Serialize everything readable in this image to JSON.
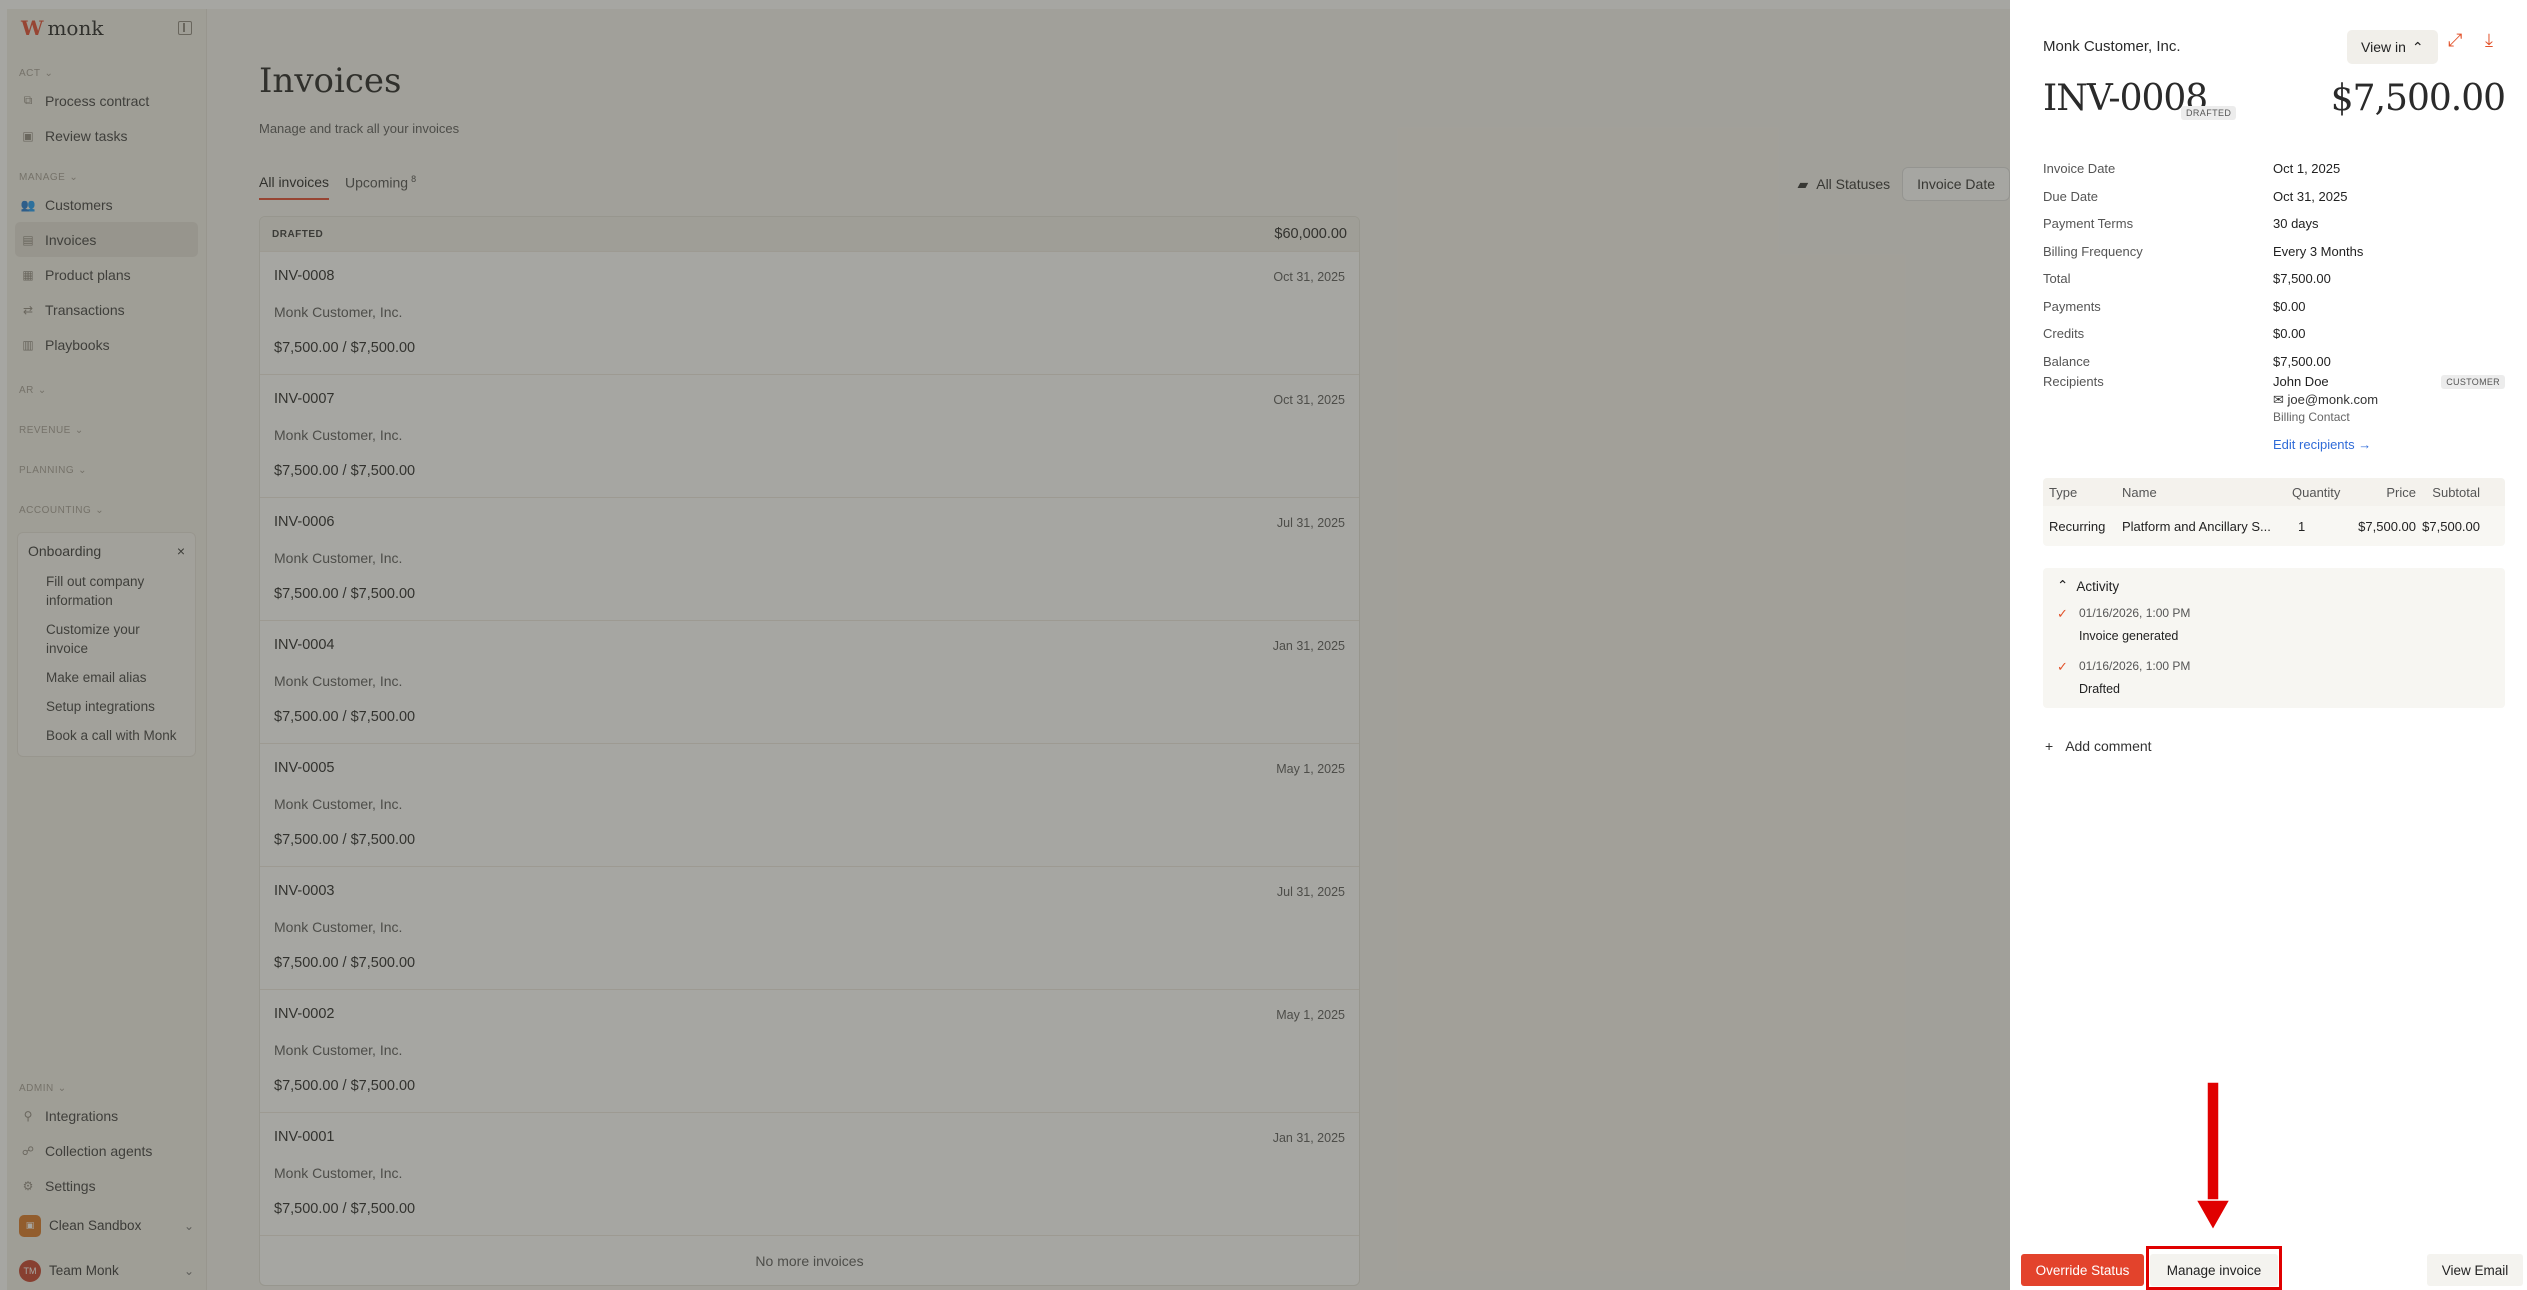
{
  "sidebar": {
    "logo": "monk",
    "sections": {
      "act": "ACT",
      "manage": "MANAGE",
      "ar": "AR",
      "revenue": "REVENUE",
      "planning": "PLANNING",
      "accounting": "ACCOUNTING",
      "admin": "ADMIN"
    },
    "act_items": [
      "Process contract",
      "Review tasks"
    ],
    "manage_items": [
      "Customers",
      "Invoices",
      "Product plans",
      "Transactions",
      "Playbooks"
    ],
    "active_item": "Invoices",
    "onboarding": {
      "title": "Onboarding",
      "items": [
        "Fill out company information",
        "Customize your invoice",
        "Make email alias",
        "Setup integrations",
        "Book a call with Monk"
      ]
    },
    "admin_items": [
      "Integrations",
      "Collection agents",
      "Settings"
    ],
    "accounts": [
      {
        "name": "Clean Sandbox",
        "initials": "",
        "color": "#d8731f"
      },
      {
        "name": "Team Monk",
        "initials": "TM",
        "color": "#c43a26"
      }
    ]
  },
  "main": {
    "title": "Invoices",
    "subtitle": "Manage and track all your invoices",
    "tabs": [
      {
        "label": "All invoices",
        "count": ""
      },
      {
        "label": "Upcoming",
        "count": "8"
      }
    ],
    "filters": {
      "status": "All Statuses",
      "date": "Invoice Date"
    },
    "group": {
      "label": "DRAFTED",
      "amount": "$60,000.00"
    },
    "invoices": [
      {
        "number": "INV-0008",
        "customer": "Monk Customer, Inc.",
        "balance": "$7,500.00 / $7,500.00",
        "date": "Oct 31, 2025"
      },
      {
        "number": "INV-0007",
        "customer": "Monk Customer, Inc.",
        "balance": "$7,500.00 / $7,500.00",
        "date": "Oct 31, 2025"
      },
      {
        "number": "INV-0006",
        "customer": "Monk Customer, Inc.",
        "balance": "$7,500.00 / $7,500.00",
        "date": "Jul 31, 2025"
      },
      {
        "number": "INV-0004",
        "customer": "Monk Customer, Inc.",
        "balance": "$7,500.00 / $7,500.00",
        "date": "Jan 31, 2025"
      },
      {
        "number": "INV-0005",
        "customer": "Monk Customer, Inc.",
        "balance": "$7,500.00 / $7,500.00",
        "date": "May 1, 2025"
      },
      {
        "number": "INV-0003",
        "customer": "Monk Customer, Inc.",
        "balance": "$7,500.00 / $7,500.00",
        "date": "Jul 31, 2025"
      },
      {
        "number": "INV-0002",
        "customer": "Monk Customer, Inc.",
        "balance": "$7,500.00 / $7,500.00",
        "date": "May 1, 2025"
      },
      {
        "number": "INV-0001",
        "customer": "Monk Customer, Inc.",
        "balance": "$7,500.00 / $7,500.00",
        "date": "Jan 31, 2025"
      }
    ],
    "footer": "No more invoices"
  },
  "drawer": {
    "customer": "Monk Customer, Inc.",
    "view_in": "View in",
    "number": "INV-0008",
    "status_badge": "DRAFTED",
    "total": "$7,500.00",
    "facts": [
      {
        "label": "Invoice Date",
        "value": "Oct 1, 2025"
      },
      {
        "label": "Due Date",
        "value": "Oct 31, 2025"
      },
      {
        "label": "Payment Terms",
        "value": "30 days"
      },
      {
        "label": "Billing Frequency",
        "value": "Every 3 Months"
      },
      {
        "label": "Total",
        "value": "$7,500.00"
      },
      {
        "label": "Payments",
        "value": "$0.00"
      },
      {
        "label": "Credits",
        "value": "$0.00"
      },
      {
        "label": "Balance",
        "value": "$7,500.00"
      }
    ],
    "recipients": {
      "label": "Recipients",
      "name": "John Doe",
      "email": "joe@monk.com",
      "role": "Billing Contact",
      "tag": "CUSTOMER",
      "edit": "Edit recipients →"
    },
    "line_items": {
      "headers": [
        "Type",
        "Name",
        "Quantity",
        "Price",
        "Subtotal"
      ],
      "rows": [
        [
          "Recurring",
          "Platform and Ancillary S...",
          "1",
          "$7,500.00",
          "$7,500.00"
        ]
      ]
    },
    "activity": {
      "title": "Activity",
      "items": [
        {
          "time": "01/16/2026, 1:00 PM",
          "text": "Invoice generated"
        },
        {
          "time": "01/16/2026, 1:00 PM",
          "text": "Drafted"
        }
      ]
    },
    "add_comment": "Add comment",
    "buttons": {
      "override": "Override Status",
      "manage": "Manage invoice",
      "view_email": "View Email"
    },
    "colors": {
      "accent": "#e3432c",
      "annotation": "#e00000"
    }
  }
}
